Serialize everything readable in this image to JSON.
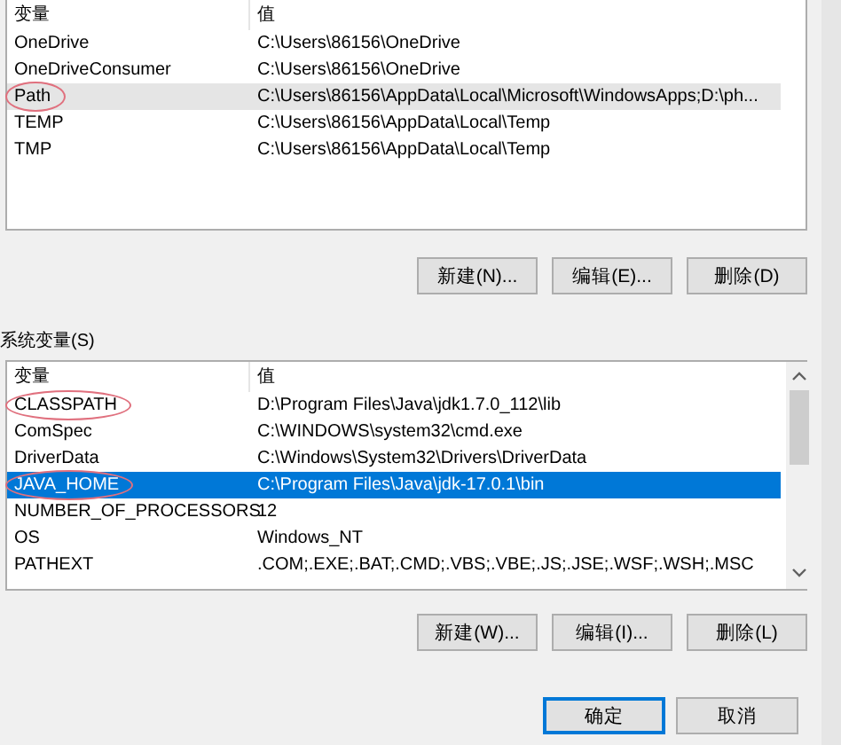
{
  "user_variables": {
    "list": {
      "focused": false,
      "columns": [
        "变量",
        "值"
      ],
      "rows": [
        {
          "name": "OneDrive",
          "value": "C:\\Users\\86156\\OneDrive",
          "selected": false,
          "circled": false
        },
        {
          "name": "OneDriveConsumer",
          "value": "C:\\Users\\86156\\OneDrive",
          "selected": false,
          "circled": false
        },
        {
          "name": "Path",
          "value": "C:\\Users\\86156\\AppData\\Local\\Microsoft\\WindowsApps;D:\\ph...",
          "selected": true,
          "circled": true
        },
        {
          "name": "TEMP",
          "value": "C:\\Users\\86156\\AppData\\Local\\Temp",
          "selected": false,
          "circled": false
        },
        {
          "name": "TMP",
          "value": "C:\\Users\\86156\\AppData\\Local\\Temp",
          "selected": false,
          "circled": false
        }
      ]
    },
    "buttons": [
      "新建(N)...",
      "编辑(E)...",
      "删除(D)"
    ]
  },
  "system_variables": {
    "label": "系统变量(S)",
    "list": {
      "focused": true,
      "columns": [
        "变量",
        "值"
      ],
      "rows": [
        {
          "name": "CLASSPATH",
          "value": "D:\\Program Files\\Java\\jdk1.7.0_112\\lib",
          "selected": false,
          "circled": true
        },
        {
          "name": "ComSpec",
          "value": "C:\\WINDOWS\\system32\\cmd.exe",
          "selected": false,
          "circled": false
        },
        {
          "name": "DriverData",
          "value": "C:\\Windows\\System32\\Drivers\\DriverData",
          "selected": false,
          "circled": false
        },
        {
          "name": "JAVA_HOME",
          "value": "C:\\Program Files\\Java\\jdk-17.0.1\\bin",
          "selected": true,
          "circled": true
        },
        {
          "name": "NUMBER_OF_PROCESSORS",
          "value": "12",
          "selected": false,
          "circled": false
        },
        {
          "name": "OS",
          "value": "Windows_NT",
          "selected": false,
          "circled": false
        },
        {
          "name": "PATHEXT",
          "value": ".COM;.EXE;.BAT;.CMD;.VBS;.VBE;.JS;.JSE;.WSF;.WSH;.MSC",
          "selected": false,
          "circled": false
        }
      ]
    },
    "buttons": [
      "新建(W)...",
      "编辑(I)...",
      "删除(L)"
    ]
  },
  "dialog_buttons": [
    {
      "label": "确定",
      "default": true
    },
    {
      "label": "取消",
      "default": false
    }
  ]
}
